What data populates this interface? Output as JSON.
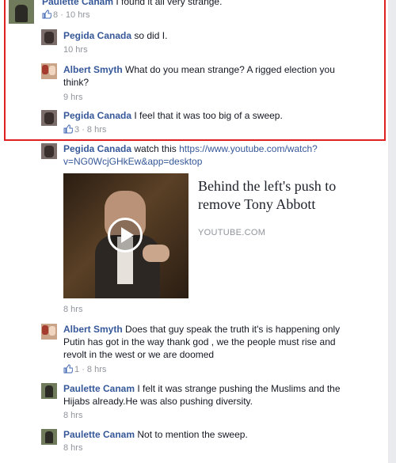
{
  "comments": {
    "c1": {
      "author": "Paulette Canam",
      "text": "I found it all very strange.",
      "likes": "8",
      "time": "10 hrs"
    },
    "c2": {
      "author": "Pegida Canada",
      "text": "so did I.",
      "time": "10 hrs"
    },
    "c3": {
      "author": "Albert Smyth",
      "text_line1": "What do you mean strange? A rigged election you",
      "text_line2": "think?",
      "time": "9 hrs"
    },
    "c4": {
      "author": "Pegida Canada",
      "text": "I feel that it was too big of a sweep.",
      "likes": "3",
      "time": "8 hrs"
    },
    "c5": {
      "author": "Pegida Canada",
      "text": "watch this",
      "link_line1": "https://www.youtube.com/watch?",
      "link_line2": "v=NG0WcjGHkEw&app=desktop",
      "time": "8 hrs"
    },
    "c6": {
      "author": "Albert Smyth",
      "text_line1": "Does that guy speak the truth it's is happening only",
      "text_line2": "Putin has got in the way thank god , we the people must rise and",
      "text_line3": "revolt in the west or we are doomed",
      "likes": "1",
      "time": "8 hrs"
    },
    "c7": {
      "author": "Paulette Canam",
      "text_line1": "I felt it was strange pushing the Muslims and the",
      "text_line2": "Hijabs already.He was also pushing diversity.",
      "time": "8 hrs"
    },
    "c8": {
      "author": "Paulette Canam",
      "text": "Not to mention the sweep.",
      "time": "8 hrs"
    }
  },
  "video": {
    "title_line1": "Behind the left's push to",
    "title_line2": "remove Tony Abbott",
    "source": "YOUTUBE.COM"
  },
  "separator": " · ",
  "colors": {
    "name": "#365899",
    "meta": "#90949c",
    "highlight": "#e02020"
  },
  "icons": {
    "like": "thumbs-up-icon",
    "play": "play-icon"
  }
}
